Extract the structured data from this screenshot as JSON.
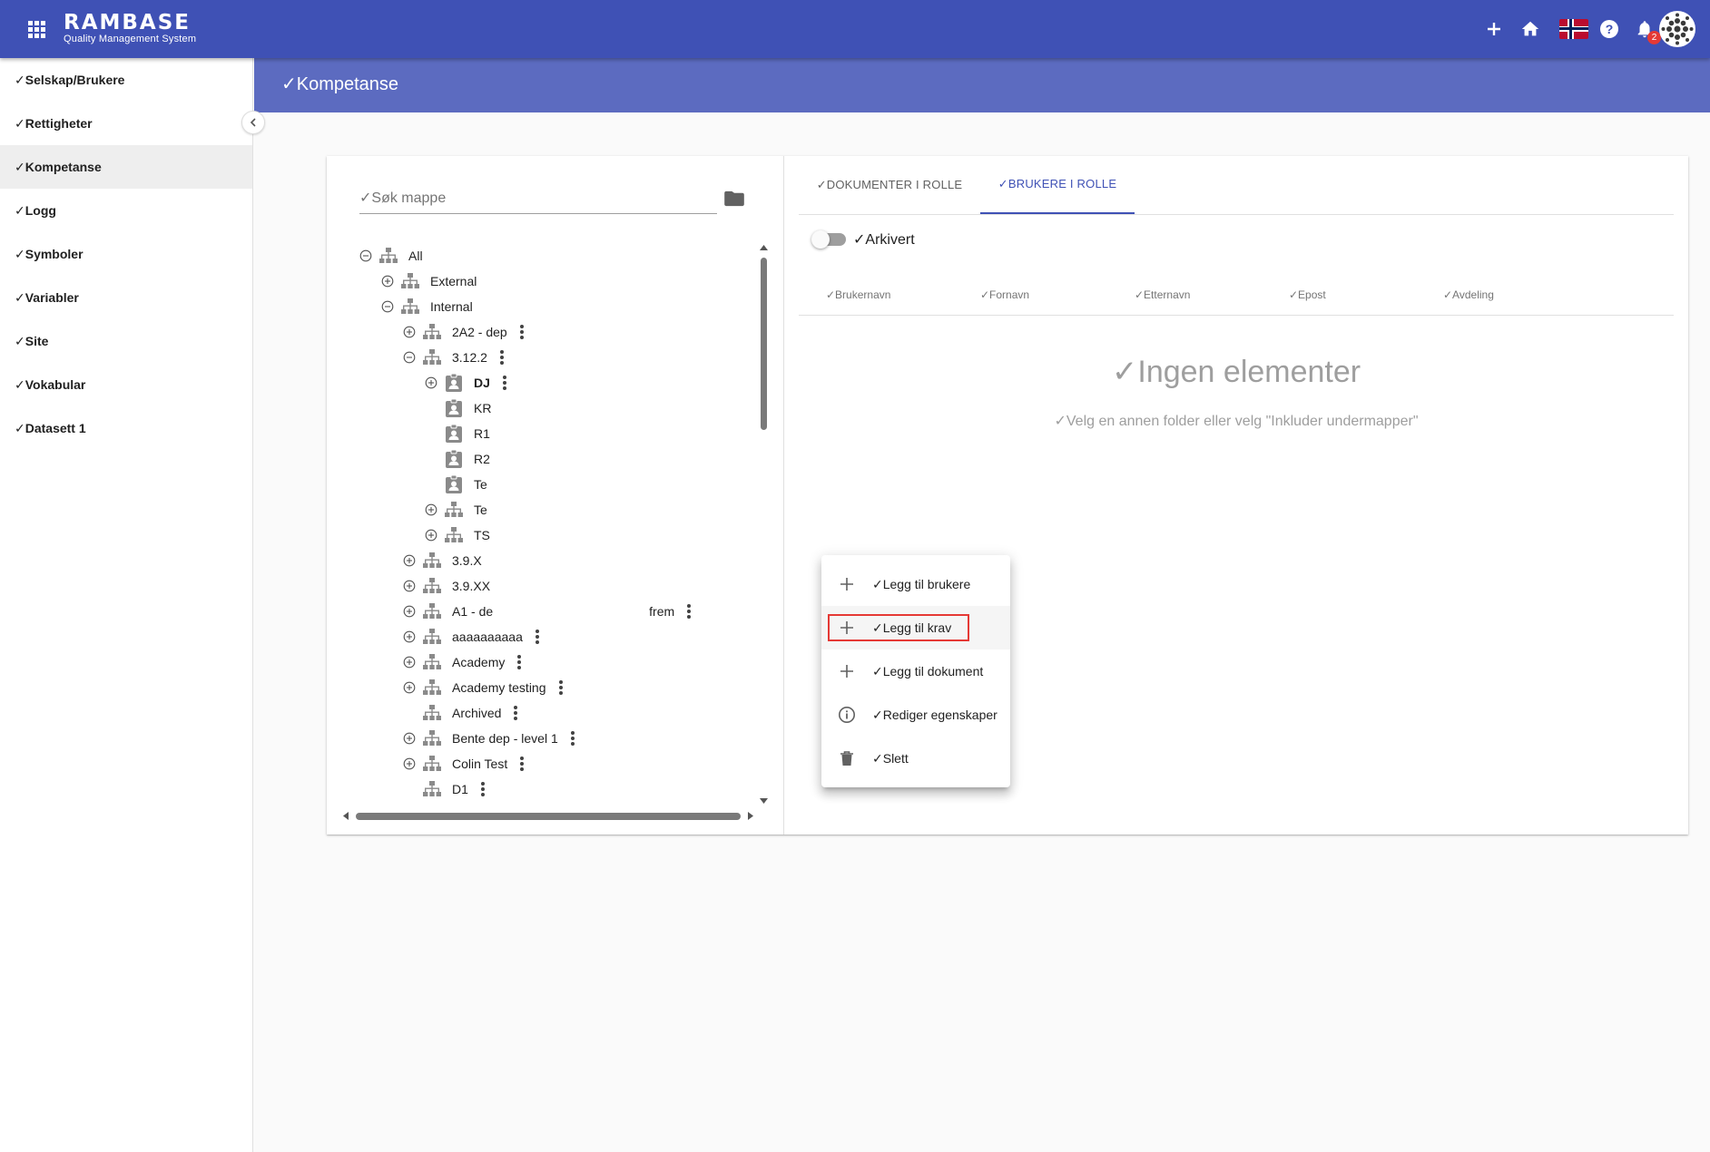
{
  "app": {
    "brand_name": "RAMBASE",
    "brand_subtitle": "Quality Management System",
    "notification_count": "2"
  },
  "sidebar": {
    "items": [
      {
        "label": "✓Selskap/Brukere"
      },
      {
        "label": "✓Rettigheter"
      },
      {
        "label": "✓Kompetanse"
      },
      {
        "label": "✓Logg"
      },
      {
        "label": "✓Symboler"
      },
      {
        "label": "✓Variabler"
      },
      {
        "label": "✓Site"
      },
      {
        "label": "✓Vokabular"
      },
      {
        "label": "✓Datasett 1"
      }
    ],
    "active_index": 2
  },
  "page": {
    "title": "✓Kompetanse"
  },
  "search": {
    "placeholder": "✓Søk mappe"
  },
  "tree": {
    "nodes": [
      {
        "label": "All"
      },
      {
        "label": "External"
      },
      {
        "label": "Internal"
      },
      {
        "label": "2A2 - dep"
      },
      {
        "label": "3.12.2"
      },
      {
        "label": "DJ"
      },
      {
        "label": "KR"
      },
      {
        "label": "R1"
      },
      {
        "label": "R2"
      },
      {
        "label": "Te"
      },
      {
        "label": "Te"
      },
      {
        "label": "TS"
      },
      {
        "label": "3.9.X"
      },
      {
        "label": "3.9.XX"
      },
      {
        "label": "A1 - de",
        "tail": "frem"
      },
      {
        "label": "aaaaaaaaaa"
      },
      {
        "label": "Academy"
      },
      {
        "label": "Academy testing"
      },
      {
        "label": "Archived"
      },
      {
        "label": "Bente dep - level 1"
      },
      {
        "label": "Colin Test"
      },
      {
        "label": "D1"
      }
    ]
  },
  "context_menu": {
    "items": [
      {
        "label": "✓Legg til brukere",
        "icon": "plus-icon"
      },
      {
        "label": "✓Legg til krav",
        "icon": "plus-icon"
      },
      {
        "label": "✓Legg til dokument",
        "icon": "plus-icon"
      },
      {
        "label": "✓Rediger egenskaper",
        "icon": "info-icon"
      },
      {
        "label": "✓Slett",
        "icon": "trash-icon"
      }
    ],
    "highlighted_index": 1
  },
  "tabs": [
    {
      "label": "✓DOKUMENTER I ROLLE"
    },
    {
      "label": "✓BRUKERE I ROLLE"
    }
  ],
  "active_tab": 1,
  "archived_toggle": {
    "label": "✓Arkivert",
    "on": false
  },
  "table": {
    "columns": [
      "✓Brukernavn",
      "✓Fornavn",
      "✓Etternavn",
      "✓Epost",
      "✓Avdeling"
    ]
  },
  "empty_state": {
    "title": "✓Ingen elementer",
    "subtitle": "✓Velg en annen folder eller velg \"Inkluder undermapper\""
  },
  "colors": {
    "primary": "#3f51b5",
    "header": "#5c6bc0",
    "highlight": "#e53935"
  }
}
